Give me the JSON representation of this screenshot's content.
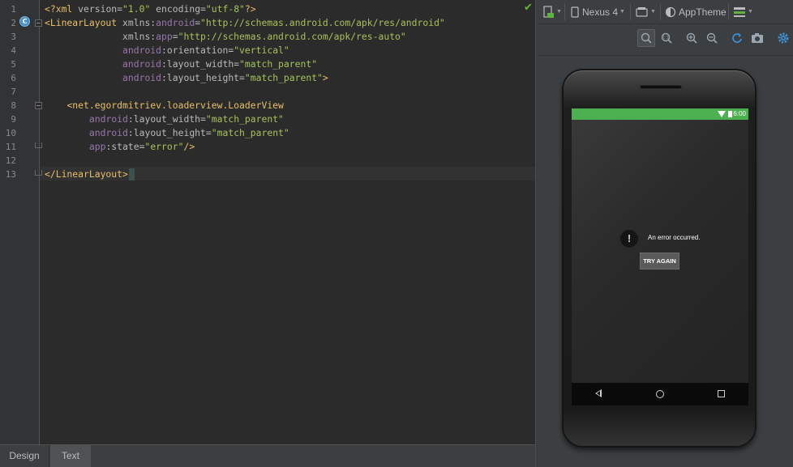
{
  "editor": {
    "line_numbers": [
      "1",
      "2",
      "3",
      "4",
      "5",
      "6",
      "7",
      "8",
      "9",
      "10",
      "11",
      "12",
      "13"
    ],
    "lines": [
      [
        {
          "t": "tag",
          "v": "<?xml "
        },
        {
          "t": "attr",
          "v": "version="
        },
        {
          "t": "val",
          "v": "\"1.0\""
        },
        {
          "t": "attr",
          "v": " encoding="
        },
        {
          "t": "val",
          "v": "\"utf-8\""
        },
        {
          "t": "tag",
          "v": "?>"
        }
      ],
      [
        {
          "t": "tag",
          "v": "<LinearLayout "
        },
        {
          "t": "attr",
          "v": "xmlns:"
        },
        {
          "t": "ns",
          "v": "android"
        },
        {
          "t": "attr",
          "v": "="
        },
        {
          "t": "val",
          "v": "\"http://schemas.android.com/apk/res/android\""
        }
      ],
      [
        {
          "t": "plain",
          "v": "              "
        },
        {
          "t": "attr",
          "v": "xmlns:"
        },
        {
          "t": "ns",
          "v": "app"
        },
        {
          "t": "attr",
          "v": "="
        },
        {
          "t": "val",
          "v": "\"http://schemas.android.com/apk/res-auto\""
        }
      ],
      [
        {
          "t": "plain",
          "v": "              "
        },
        {
          "t": "ns",
          "v": "android"
        },
        {
          "t": "attr",
          "v": ":orientation="
        },
        {
          "t": "val",
          "v": "\"vertical\""
        }
      ],
      [
        {
          "t": "plain",
          "v": "              "
        },
        {
          "t": "ns",
          "v": "android"
        },
        {
          "t": "attr",
          "v": ":layout_width="
        },
        {
          "t": "val",
          "v": "\"match_parent\""
        }
      ],
      [
        {
          "t": "plain",
          "v": "              "
        },
        {
          "t": "ns",
          "v": "android"
        },
        {
          "t": "attr",
          "v": ":layout_height="
        },
        {
          "t": "val",
          "v": "\"match_parent\""
        },
        {
          "t": "tag",
          "v": ">"
        }
      ],
      [],
      [
        {
          "t": "plain",
          "v": "    "
        },
        {
          "t": "tag",
          "v": "<net.egordmitriev.loaderview.LoaderView"
        }
      ],
      [
        {
          "t": "plain",
          "v": "        "
        },
        {
          "t": "ns",
          "v": "android"
        },
        {
          "t": "attr",
          "v": ":layout_width="
        },
        {
          "t": "val",
          "v": "\"match_parent\""
        }
      ],
      [
        {
          "t": "plain",
          "v": "        "
        },
        {
          "t": "ns",
          "v": "android"
        },
        {
          "t": "attr",
          "v": ":layout_height="
        },
        {
          "t": "val",
          "v": "\"match_parent\""
        }
      ],
      [
        {
          "t": "plain",
          "v": "        "
        },
        {
          "t": "ns",
          "v": "app"
        },
        {
          "t": "attr",
          "v": ":state="
        },
        {
          "t": "val",
          "v": "\"error\""
        },
        {
          "t": "tag",
          "v": "/>"
        }
      ],
      [],
      [
        {
          "t": "tag",
          "v": "</LinearLayout>"
        }
      ]
    ]
  },
  "bottom_tabs": {
    "design": "Design",
    "text": "Text"
  },
  "toolbar": {
    "device": "Nexus 4",
    "theme": "AppTheme",
    "zoom_actual_label": "1:1"
  },
  "device_screen": {
    "status_time": "6:00",
    "error_icon_glyph": "!",
    "error_message": "An error occurred.",
    "retry_button": "TRY AGAIN",
    "status_bar_color": "#4caf50"
  },
  "icons": {
    "class_badge": "C",
    "check": "✔"
  }
}
